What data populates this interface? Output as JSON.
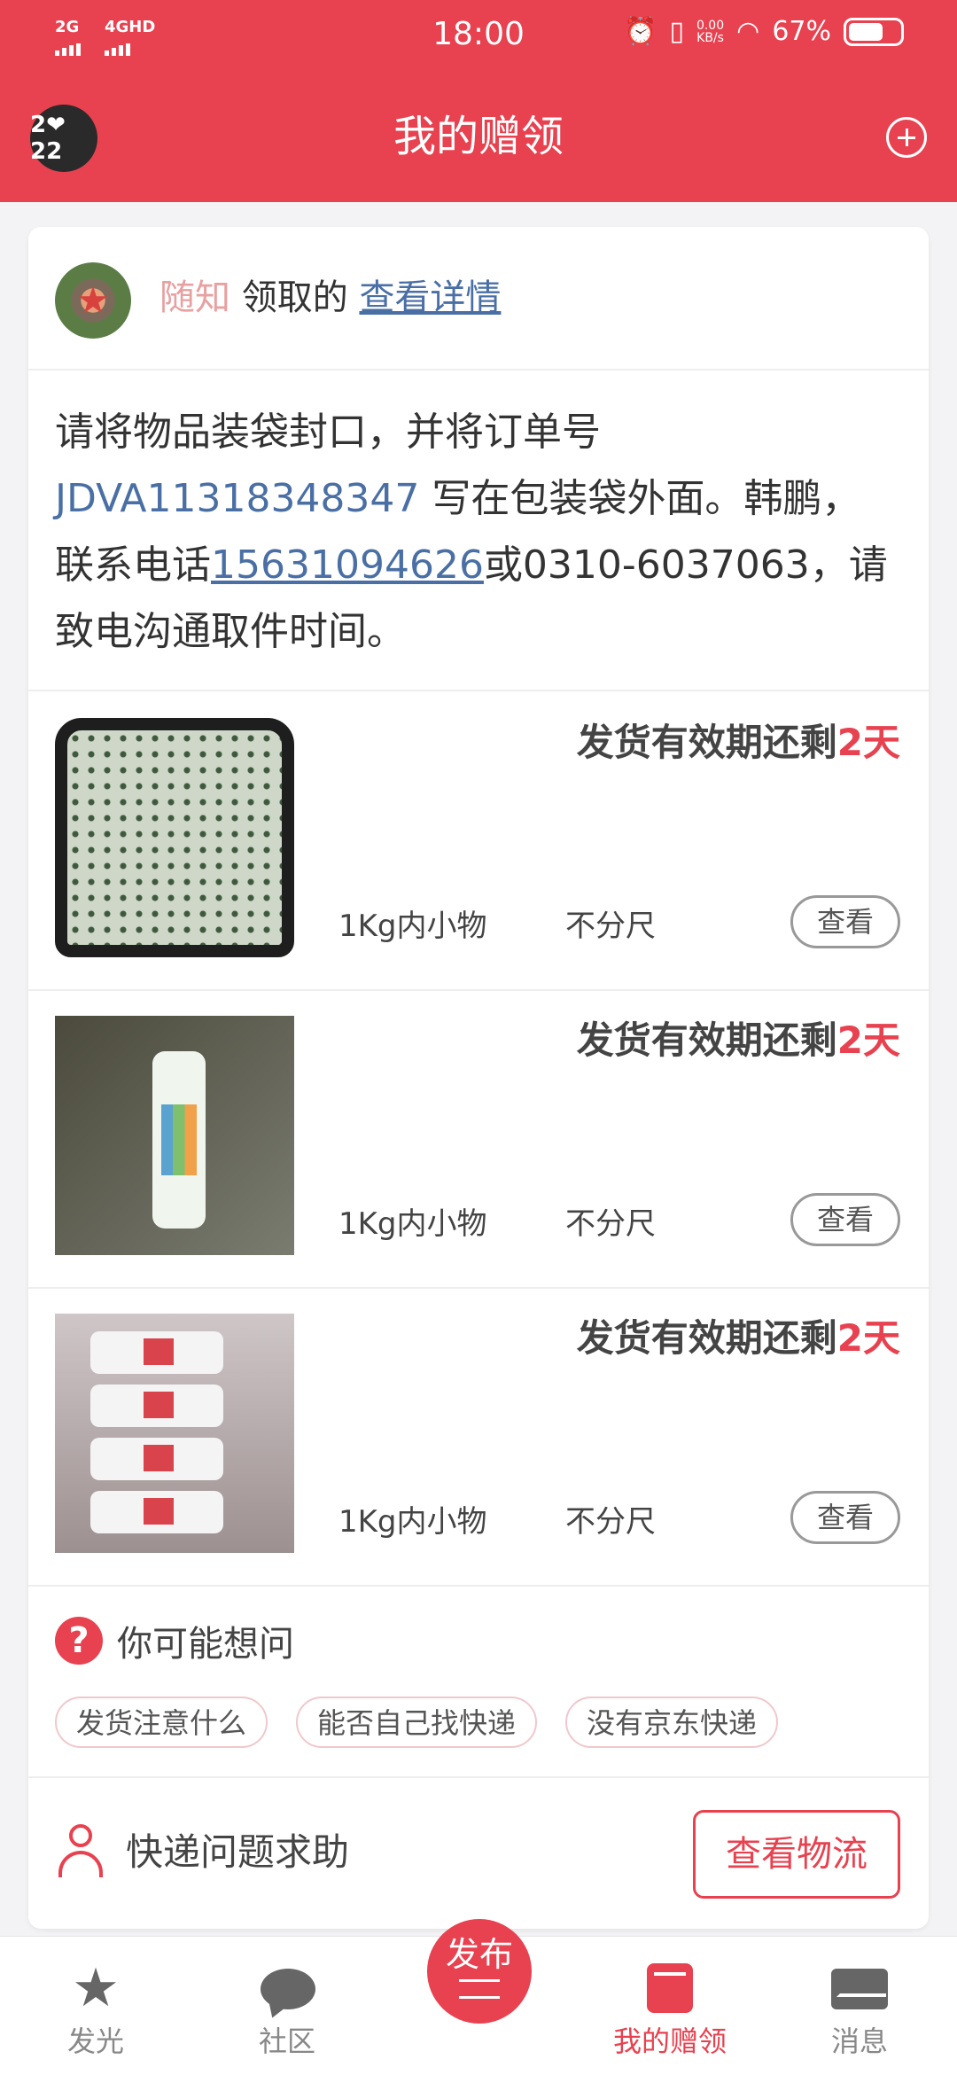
{
  "status_bar": {
    "signal1": "2G",
    "signal2": "4GHD",
    "time": "18:00",
    "net_speed": "0.00",
    "net_unit": "KB/s",
    "battery": "67%"
  },
  "header": {
    "badge": "2❤22",
    "title": "我的赠领"
  },
  "giver": {
    "name": "随知",
    "action": " 领取的 ",
    "detail_link": "查看详情"
  },
  "instructions": {
    "part1": "请将物品装袋封口，并将订单号 ",
    "order_no": "JDVA11318348347",
    "part2": " 写在包装袋外面。韩鹏，联系电话",
    "phone": "15631094626",
    "part3": "或0310-6037063，请致电沟通取件时间。"
  },
  "items": [
    {
      "expiry_prefix": "发货有效期还剩",
      "expiry_days": "2天",
      "weight": "1Kg内小物",
      "size": "不分尺",
      "view": "查看",
      "image": "mask"
    },
    {
      "expiry_prefix": "发货有效期还剩",
      "expiry_days": "2天",
      "weight": "1Kg内小物",
      "size": "不分尺",
      "view": "查看",
      "image": "spray-bottle"
    },
    {
      "expiry_prefix": "发货有效期还剩",
      "expiry_days": "2天",
      "weight": "1Kg内小物",
      "size": "不分尺",
      "view": "查看",
      "image": "spray-bottles"
    }
  ],
  "faq": {
    "icon": "question-icon",
    "title": "你可能想问",
    "chips": [
      "发货注意什么",
      "能否自己找快递",
      "没有京东快递"
    ]
  },
  "help": {
    "title": "快递问题求助",
    "track_button": "查看物流"
  },
  "bottom_nav": {
    "items": [
      {
        "label": "发光",
        "icon": "star-icon"
      },
      {
        "label": "社区",
        "icon": "chat-bubble-icon"
      },
      {
        "label": "发布",
        "icon": "menu-lines-icon"
      },
      {
        "label": "我的赠领",
        "icon": "book-icon",
        "active": true
      },
      {
        "label": "消息",
        "icon": "mail-icon"
      }
    ]
  },
  "colors": {
    "brand": "#e8414f",
    "link": "#4a6fa5"
  }
}
